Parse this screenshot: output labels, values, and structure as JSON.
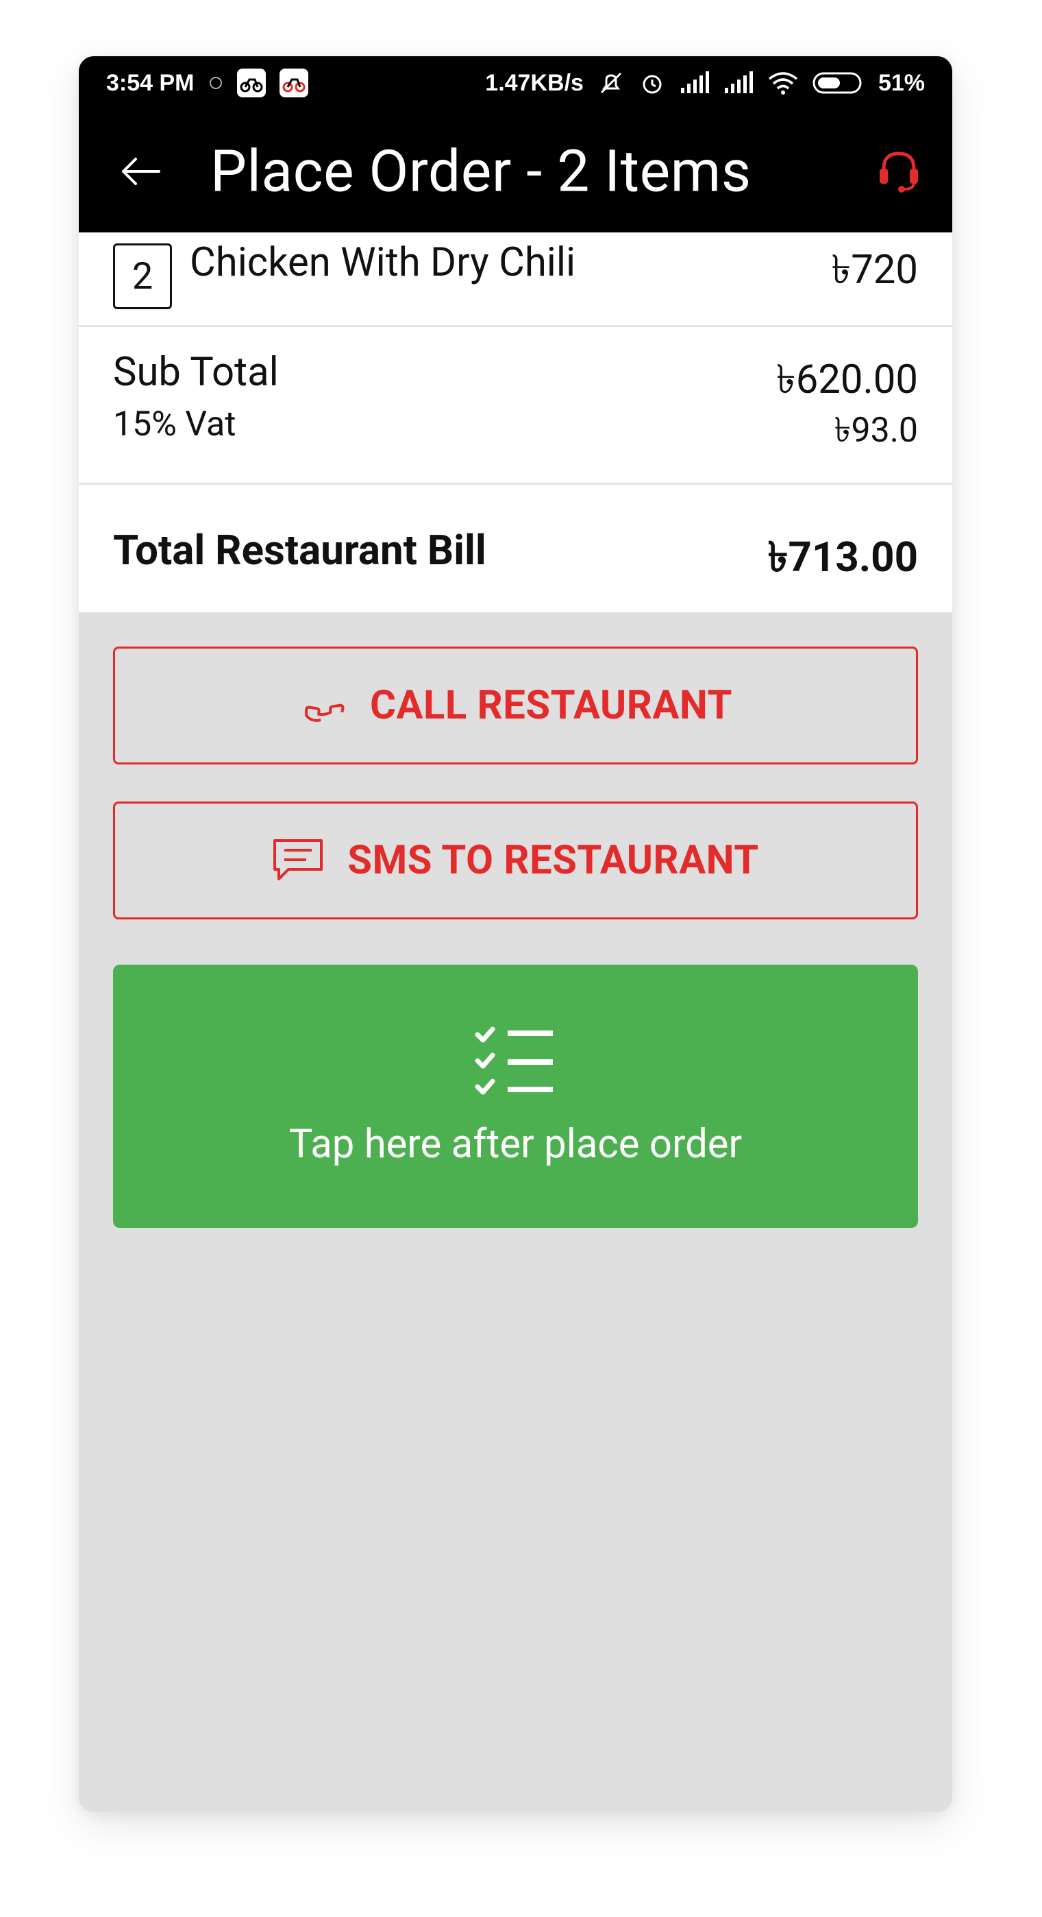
{
  "status_bar": {
    "time": "3:54 PM",
    "net_speed": "1.47KB/s",
    "battery": "51%"
  },
  "app_bar": {
    "title": "Place Order - 2 Items",
    "back_icon": "arrow-left-icon",
    "support_icon": "headset-icon"
  },
  "order": {
    "items": [
      {
        "qty": "2",
        "name": "Chicken With Dry Chili",
        "price": "৳720"
      }
    ],
    "subtotal_label": "Sub Total",
    "subtotal_value": "৳620.00",
    "vat_label": "15% Vat",
    "vat_value": "৳93.0",
    "bill_label": "Total Restaurant Bill",
    "bill_value": "৳713.00"
  },
  "actions": {
    "call_label": "CALL RESTAURANT",
    "sms_label": "SMS TO RESTAURANT",
    "confirm_label": "Tap here after place order"
  },
  "colors": {
    "accent_red": "#e32b2b",
    "confirm_green": "#4caf50",
    "background_grey": "#dfdfdf"
  }
}
